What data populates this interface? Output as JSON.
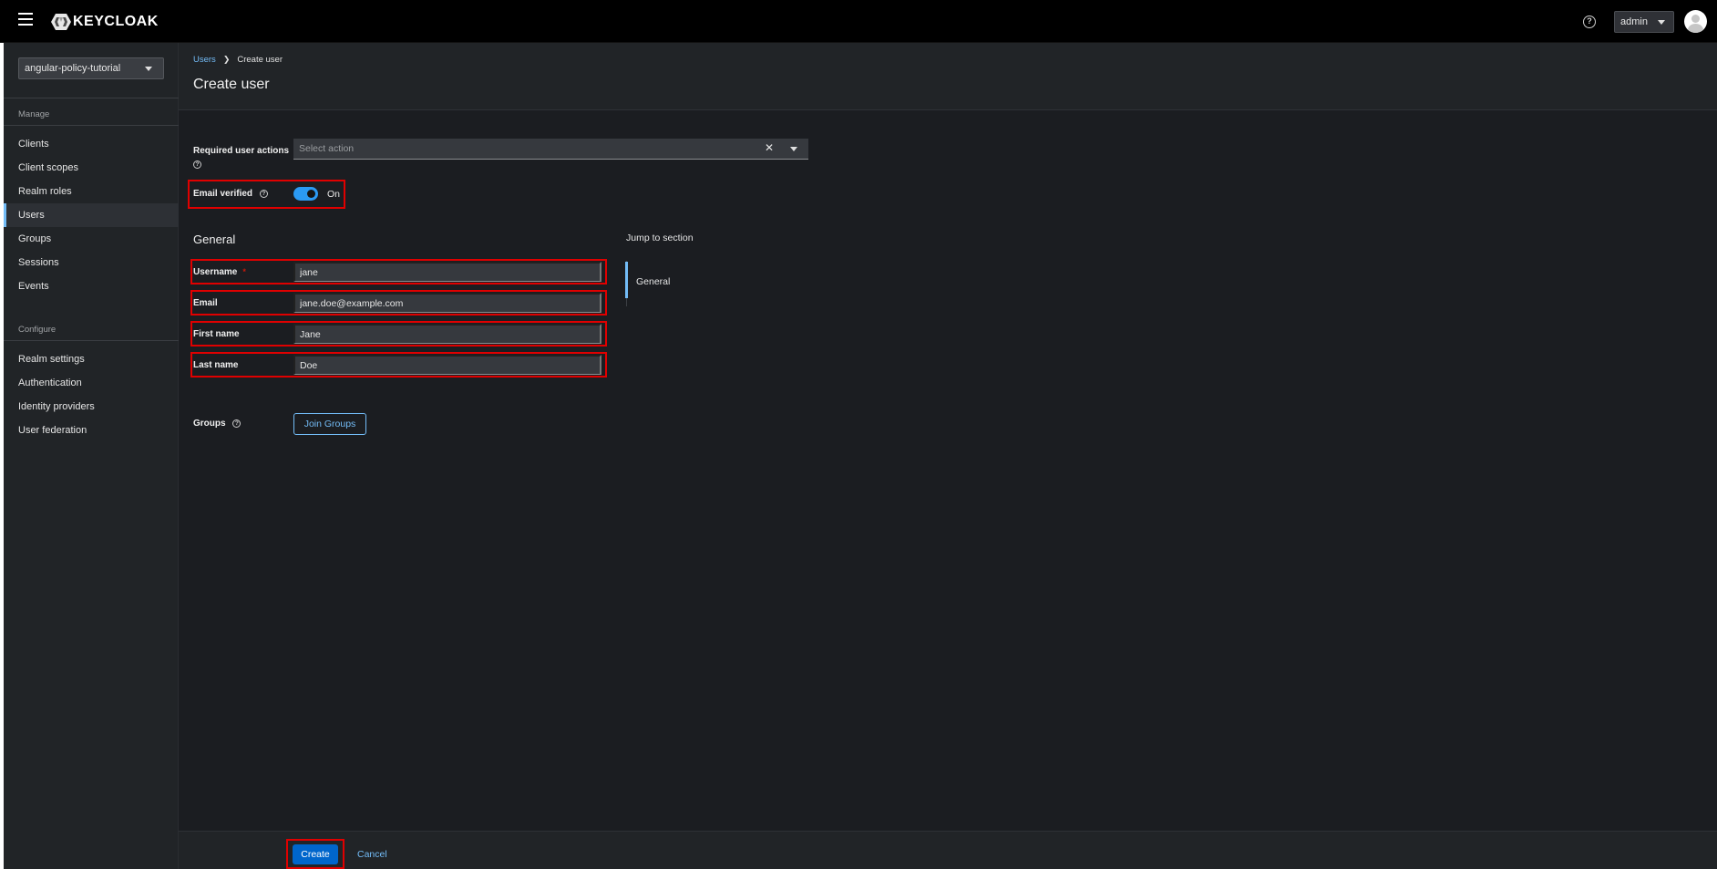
{
  "masthead": {
    "logo_text_bold": "KEYCLOAK",
    "help_icon": "help-circle-icon",
    "user_label": "admin",
    "avatar_icon": "user-avatar-icon"
  },
  "sidebar": {
    "realm": "angular-policy-tutorial",
    "manage_heading": "Manage",
    "manage_items": [
      "Clients",
      "Client scopes",
      "Realm roles",
      "Users",
      "Groups",
      "Sessions",
      "Events"
    ],
    "configure_heading": "Configure",
    "configure_items": [
      "Realm settings",
      "Authentication",
      "Identity providers",
      "User federation"
    ],
    "active_item": "Users"
  },
  "breadcrumb": {
    "parent": "Users",
    "current": "Create user"
  },
  "page": {
    "title": "Create user"
  },
  "form": {
    "required_actions_label": "Required user actions",
    "required_actions_placeholder": "Select action",
    "email_verified_label": "Email verified",
    "email_verified_state": "On",
    "general_title": "General",
    "username_label": "Username",
    "username_required_mark": "*",
    "username_value": "jane",
    "email_label": "Email",
    "email_value": "jane.doe@example.com",
    "first_name_label": "First name",
    "first_name_value": "Jane",
    "last_name_label": "Last name",
    "last_name_value": "Doe",
    "groups_label": "Groups",
    "join_groups_button": "Join Groups"
  },
  "jump": {
    "title": "Jump to section",
    "items": [
      "General"
    ]
  },
  "footer": {
    "create_button": "Create",
    "cancel_button": "Cancel"
  },
  "colors": {
    "accent": "#0066cc",
    "link": "#73bcf7",
    "highlight": "#e00000",
    "toggle_on": "#2b9af3"
  }
}
